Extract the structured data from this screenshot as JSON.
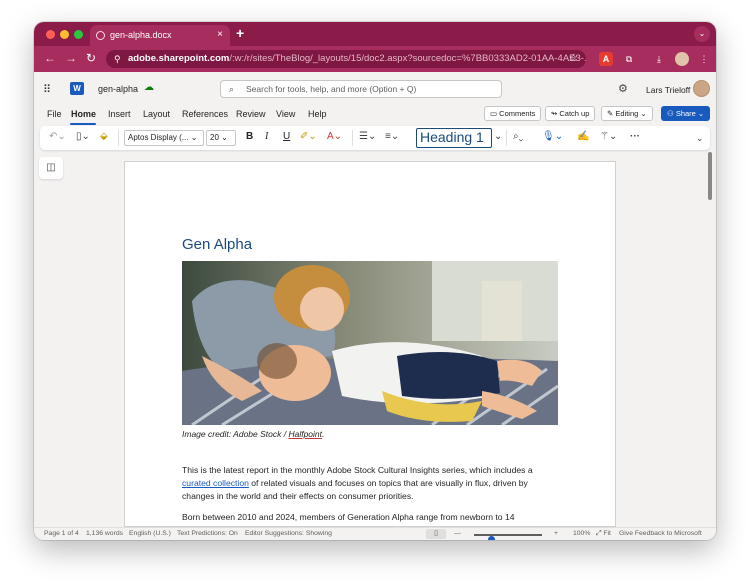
{
  "browser": {
    "tab_title": "gen-alpha.docx",
    "tab_close": "×",
    "new_tab": "+",
    "tab_menu": "⌄",
    "back": "←",
    "forward": "→",
    "reload": "↻",
    "url_host": "adobe.sharepoint.com",
    "url_path": "/:w:/r/sites/TheBlog/_layouts/15/doc2.aspx?sourcedoc=%7BB0333AD2-01AA-4AE3-...",
    "star": "☆",
    "ext_adobe": "A",
    "ext_puzzle": "⧉",
    "ext_download": "⤓",
    "ext_more": "⋮"
  },
  "app": {
    "waffle": "⠿",
    "logo": "W",
    "doc_name": "gen-alpha",
    "search_placeholder": "Search for tools, help, and more (Option + Q)",
    "settings": "⚙",
    "user_name": "Lars Trieloff"
  },
  "ribbon_tabs": [
    "File",
    "Home",
    "Insert",
    "Layout",
    "References",
    "Review",
    "View",
    "Help"
  ],
  "actions": {
    "comments": "Comments",
    "catch_up": "Catch up",
    "editing": "Editing",
    "share": "Share"
  },
  "ribbon": {
    "font_name": "Aptos Display (...",
    "font_size": "20",
    "bold": "B",
    "italic": "I",
    "underline": "U",
    "style": "Heading 1",
    "more": "···"
  },
  "document": {
    "heading": "Gen Alpha",
    "caption_prefix": "Image credit: Adobe Stock / ",
    "caption_link": "Halfpoint",
    "caption_suffix": ".",
    "para1_a": "This is the latest report in the monthly Adobe Stock Cultural Insights series, which includes a ",
    "para1_link": "curated collection",
    "para1_b": " of related visuals and focuses on topics that are visually in flux, driven by changes in the world and their effects on consumer priorities.",
    "para2": "Born between 2010 and 2024, members of Generation Alpha range from newborn to 14"
  },
  "status": {
    "page": "Page 1 of 4",
    "words": "1,136 words",
    "language": "English (U.S.)",
    "predictions": "Text Predictions: On",
    "suggestions": "Editor Suggestions: Showing",
    "zoom_minus": "—",
    "zoom_plus": "+",
    "zoom": "100%",
    "fit": "Fit",
    "feedback": "Give Feedback to Microsoft",
    "zoom_fraction": 0.25
  },
  "colors": {
    "browser_frame": "#8b1c49",
    "word_blue": "#185abd",
    "heading_blue": "#1a4a7a"
  }
}
